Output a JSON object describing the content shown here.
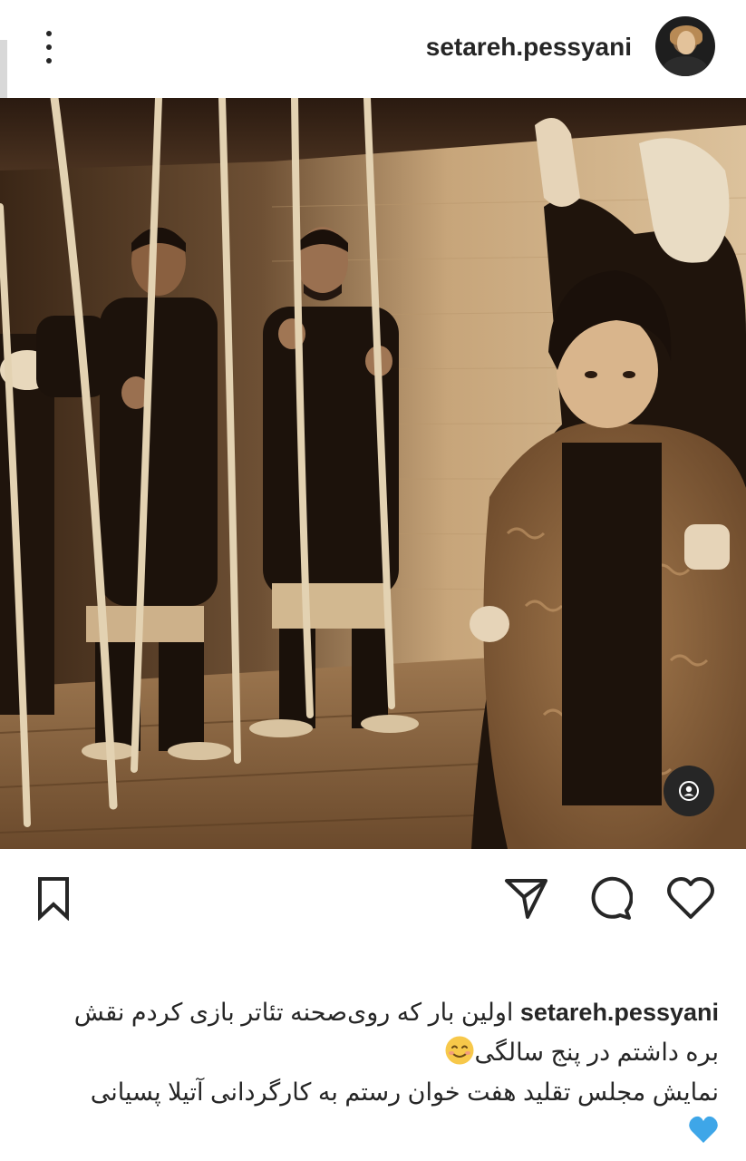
{
  "header": {
    "username": "setareh.pessyani",
    "more_icon": "more-vertical-icon",
    "avatar_icon": "profile-avatar"
  },
  "post": {
    "photo": "sepia theatre stage photo",
    "tag_icon": "user-tag-icon"
  },
  "actions": {
    "like_icon": "heart-icon",
    "comment_icon": "comment-icon",
    "share_icon": "send-icon",
    "save_icon": "bookmark-icon"
  },
  "caption": {
    "username": "setareh.pessyani",
    "line1": "اولین بار که روی‌صحنه تئاتر بازی کردم نقش",
    "line2": "بره داشتم در پنج سالگی",
    "line3": "نمایش مجلس تقلید هفت خوان رستم به کارگردانی آتیلا پسیانی",
    "emoji1": "smiling-face-emoji",
    "emoji2": "blue-heart-emoji"
  },
  "colors": {
    "text": "#262626",
    "background": "#ffffff",
    "sepia_light": "#d8bb92",
    "sepia_dark": "#2a1a10",
    "blue_heart": "#3ea6e8",
    "smile_yellow": "#f7c84a"
  }
}
